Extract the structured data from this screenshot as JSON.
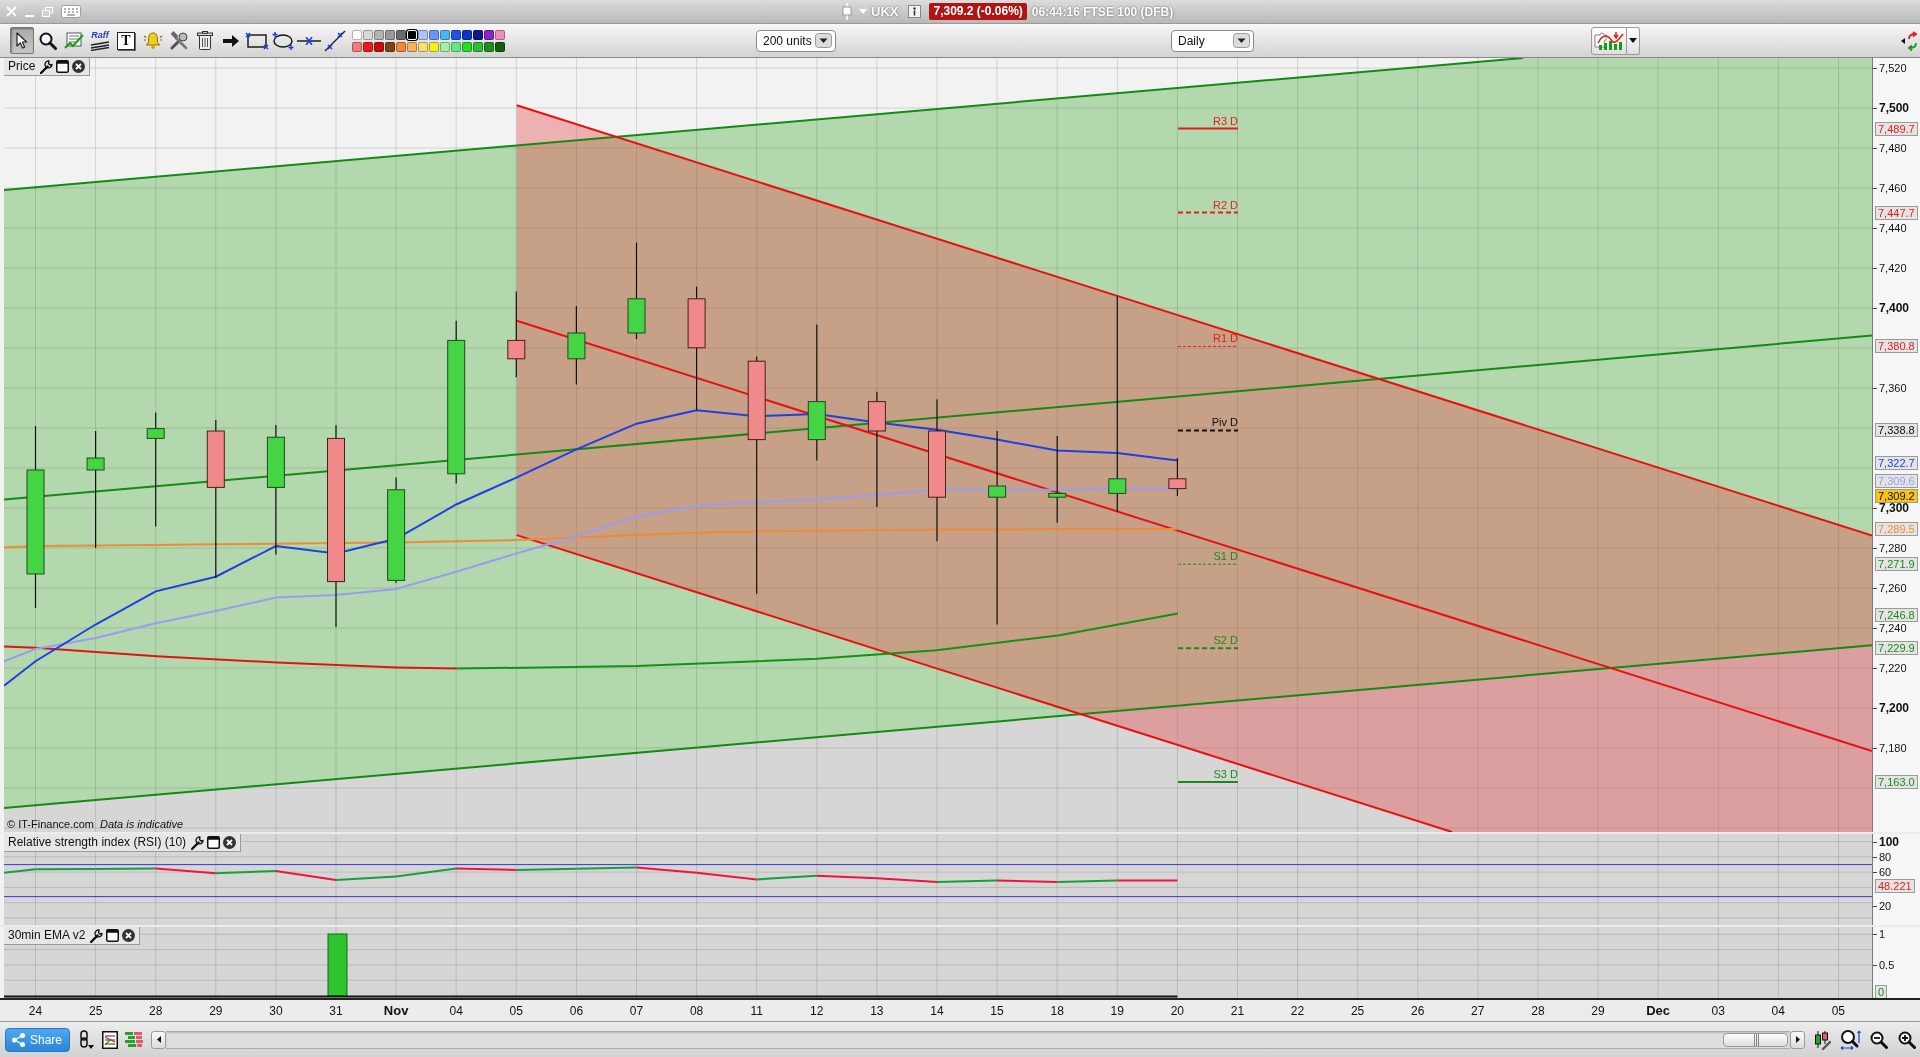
{
  "title_bar": {
    "symbol": "UKX",
    "price_badge": "7,309.2 (-0.06%)",
    "status": "06:44:16 FTSE 100 (DFB)"
  },
  "toolbar": {
    "tools": [
      {
        "kind": "pointer",
        "selected": true
      },
      {
        "kind": "zoom",
        "selected": false
      },
      {
        "kind": "indicator",
        "selected": false
      },
      {
        "kind": "raff",
        "label": "Raff",
        "selected": false
      },
      {
        "kind": "text",
        "label": "T",
        "selected": false
      },
      {
        "kind": "alert",
        "selected": false
      },
      {
        "kind": "tools",
        "selected": false
      },
      {
        "kind": "delete",
        "selected": false
      },
      {
        "kind": "arrow",
        "selected": false
      },
      {
        "kind": "rectangle",
        "selected": false
      },
      {
        "kind": "ellipse",
        "selected": false
      },
      {
        "kind": "horizontal",
        "selected": false
      },
      {
        "kind": "trendline",
        "selected": false
      }
    ],
    "palette": [
      {
        "color": "#ffffff",
        "selected": false
      },
      {
        "color": "#d9d9d9",
        "selected": false
      },
      {
        "color": "#b3b3b3",
        "selected": false
      },
      {
        "color": "#999999",
        "selected": false
      },
      {
        "color": "#6b6b6b",
        "selected": false
      },
      {
        "color": "#000000",
        "selected": true
      },
      {
        "color": "#a9c6f7",
        "selected": false
      },
      {
        "color": "#6f95f2",
        "selected": false
      },
      {
        "color": "#4fb3f2",
        "selected": false
      },
      {
        "color": "#1f52e6",
        "selected": false
      },
      {
        "color": "#1233c2",
        "selected": false
      },
      {
        "color": "#0e1a86",
        "selected": false
      },
      {
        "color": "#8a24c4",
        "selected": false
      },
      {
        "color": "#f28cc0",
        "selected": false
      },
      {
        "color": "#f27a7a",
        "selected": false
      },
      {
        "color": "#e81c1c",
        "selected": false
      },
      {
        "color": "#c41010",
        "selected": false
      },
      {
        "color": "#7e4414",
        "selected": false
      },
      {
        "color": "#f2883a",
        "selected": false
      },
      {
        "color": "#f7b25e",
        "selected": false
      },
      {
        "color": "#f7df72",
        "selected": false
      },
      {
        "color": "#f5ef22",
        "selected": false
      },
      {
        "color": "#a3f0a3",
        "selected": false
      },
      {
        "color": "#64e884",
        "selected": false
      },
      {
        "color": "#22e022",
        "selected": false
      },
      {
        "color": "#2fbf2f",
        "selected": false
      },
      {
        "color": "#1f8f1f",
        "selected": false
      },
      {
        "color": "#0f5f0f",
        "selected": false
      }
    ],
    "units_select": {
      "value": "200 units"
    },
    "period_select": {
      "value": "Daily"
    }
  },
  "price_panel": {
    "title": "Price",
    "axis_labels": [
      {
        "text": "7,520",
        "kind": "minor"
      },
      {
        "text": "7,500",
        "kind": "major"
      },
      {
        "text": "7,480",
        "kind": "minor"
      },
      {
        "text": "7,460",
        "kind": "minor"
      },
      {
        "text": "7,440",
        "kind": "minor"
      },
      {
        "text": "7,420",
        "kind": "minor"
      },
      {
        "text": "7,400",
        "kind": "major"
      },
      {
        "text": "7,360",
        "kind": "minor"
      },
      {
        "text": "7,300",
        "kind": "major"
      },
      {
        "text": "7,280",
        "kind": "minor"
      },
      {
        "text": "7,260",
        "kind": "minor"
      },
      {
        "text": "7,240",
        "kind": "minor"
      },
      {
        "text": "7,220",
        "kind": "minor"
      },
      {
        "text": "7,200",
        "kind": "major"
      },
      {
        "text": "7,180",
        "kind": "minor"
      }
    ],
    "price_tags": [
      {
        "text": "7,489.7",
        "color": "#e81c1c",
        "kind": "level"
      },
      {
        "text": "7,447.7",
        "color": "#e81c1c",
        "kind": "level"
      },
      {
        "text": "7,380.8",
        "color": "#e81c1c",
        "kind": "level"
      },
      {
        "text": "7,338.8",
        "color": "#111111",
        "kind": "level"
      },
      {
        "text": "7,322.7",
        "color": "#2244e0",
        "kind": "level"
      },
      {
        "text": "7,309.6",
        "color": "#9a9cf0",
        "kind": "level"
      },
      {
        "text": "7,309.2",
        "color": "#f7c511",
        "kind": "current"
      },
      {
        "text": "7,289.5",
        "color": "#f08a34",
        "kind": "level"
      },
      {
        "text": "7,271.9",
        "color": "#1a8a1a",
        "kind": "level"
      },
      {
        "text": "7,246.8",
        "color": "#1a8a1a",
        "kind": "level"
      },
      {
        "text": "7,229.9",
        "color": "#1a8a1a",
        "kind": "level"
      },
      {
        "text": "7,163.0",
        "color": "#1a8a1a",
        "kind": "level"
      }
    ],
    "pivots": [
      {
        "label": "R3 D",
        "color": "#e81c1c",
        "kind": "solid"
      },
      {
        "label": "R2 D",
        "color": "#e81c1c",
        "kind": "dashed"
      },
      {
        "label": "R1 D",
        "color": "#e81c1c",
        "kind": "fine"
      },
      {
        "label": "Piv D",
        "color": "#111111",
        "kind": "dashed"
      },
      {
        "label": "S1 D",
        "color": "#1a8a1a",
        "kind": "fine"
      },
      {
        "label": "S2 D",
        "color": "#1a8a1a",
        "kind": "dashed"
      },
      {
        "label": "S3 D",
        "color": "#1a8a1a",
        "kind": "solid"
      }
    ],
    "copyright": "© IT-Finance.com",
    "disclaimer": "Data is indicative"
  },
  "rsi_panel": {
    "title": "Relative strength index (RSI) (10)",
    "axis_labels": [
      {
        "text": "100",
        "kind": "major"
      },
      {
        "text": "80",
        "kind": "minor"
      },
      {
        "text": "60",
        "kind": "minor"
      },
      {
        "text": "20",
        "kind": "minor"
      }
    ],
    "value_tag": "48.221"
  },
  "ema_panel": {
    "title": "30min EMA v2",
    "axis_labels": [
      "1",
      "0.5"
    ],
    "value_tag": "0"
  },
  "date_axis": [
    {
      "text": "24",
      "kind": "day"
    },
    {
      "text": "25",
      "kind": "day"
    },
    {
      "text": "28",
      "kind": "day"
    },
    {
      "text": "29",
      "kind": "day"
    },
    {
      "text": "30",
      "kind": "day"
    },
    {
      "text": "31",
      "kind": "day"
    },
    {
      "text": "Nov",
      "kind": "month"
    },
    {
      "text": "04",
      "kind": "day"
    },
    {
      "text": "05",
      "kind": "day"
    },
    {
      "text": "06",
      "kind": "day"
    },
    {
      "text": "07",
      "kind": "day"
    },
    {
      "text": "08",
      "kind": "day"
    },
    {
      "text": "11",
      "kind": "day"
    },
    {
      "text": "12",
      "kind": "day"
    },
    {
      "text": "13",
      "kind": "day"
    },
    {
      "text": "14",
      "kind": "day"
    },
    {
      "text": "15",
      "kind": "day"
    },
    {
      "text": "18",
      "kind": "day"
    },
    {
      "text": "19",
      "kind": "day"
    },
    {
      "text": "20",
      "kind": "day"
    },
    {
      "text": "21",
      "kind": "day"
    },
    {
      "text": "22",
      "kind": "day"
    },
    {
      "text": "25",
      "kind": "day"
    },
    {
      "text": "26",
      "kind": "day"
    },
    {
      "text": "27",
      "kind": "day"
    },
    {
      "text": "28",
      "kind": "day"
    },
    {
      "text": "29",
      "kind": "day"
    },
    {
      "text": "Dec",
      "kind": "month"
    },
    {
      "text": "03",
      "kind": "day"
    },
    {
      "text": "04",
      "kind": "day"
    },
    {
      "text": "05",
      "kind": "day"
    }
  ],
  "bottom_bar": {
    "share_button": "Share"
  }
}
